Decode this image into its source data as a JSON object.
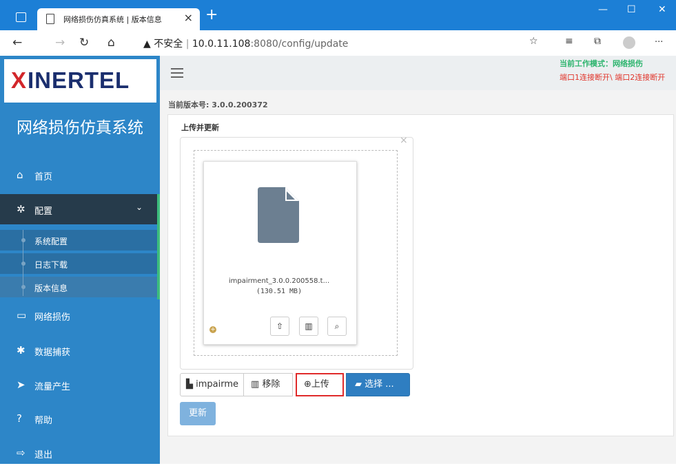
{
  "browser": {
    "tab_title": "网络损伤仿真系统 | 版本信息",
    "tab_close": "×",
    "new_tab": "+",
    "insecure_label": "不安全",
    "url_host": "10.0.11.108",
    "url_rest": ":8080/config/update",
    "more": "···"
  },
  "logo": {
    "x": "X",
    "text": "INERTEL"
  },
  "sidebar": {
    "system_title": "网络损伤仿真系统",
    "items": [
      {
        "label": "首页",
        "icon": "home-icon"
      },
      {
        "label": "配置",
        "icon": "gear-icon"
      },
      {
        "label": "网络损伤",
        "icon": "monitor-icon"
      },
      {
        "label": "数据捕获",
        "icon": "bug-icon"
      },
      {
        "label": "流量产生",
        "icon": "send-icon"
      },
      {
        "label": "帮助",
        "icon": "help-icon"
      },
      {
        "label": "退出",
        "icon": "logout-icon"
      }
    ],
    "subitems": [
      {
        "label": "系统配置"
      },
      {
        "label": "日志下载"
      },
      {
        "label": "版本信息"
      }
    ]
  },
  "header": {
    "mode": "当前工作模式：网络损伤",
    "connection": "端口1连接断开\\ 端口2连接断开"
  },
  "main": {
    "version": "当前版本号: 3.0.0.200372",
    "upload_label": "上传并更新",
    "file_name": "impairment_3.0.0.200558.t...",
    "file_size": "(130.51 MB)",
    "file_input_value": "impairme",
    "remove_label": "移除",
    "upload_button": "上传",
    "select_button": "选择 ...",
    "update_button": "更新"
  },
  "colors": {
    "sidebar": "#2d86c8",
    "active_menu": "#263b4b",
    "mode_text": "#2fb56f",
    "conn_text": "#e1352b",
    "highlight_border": "#e02a2a"
  }
}
